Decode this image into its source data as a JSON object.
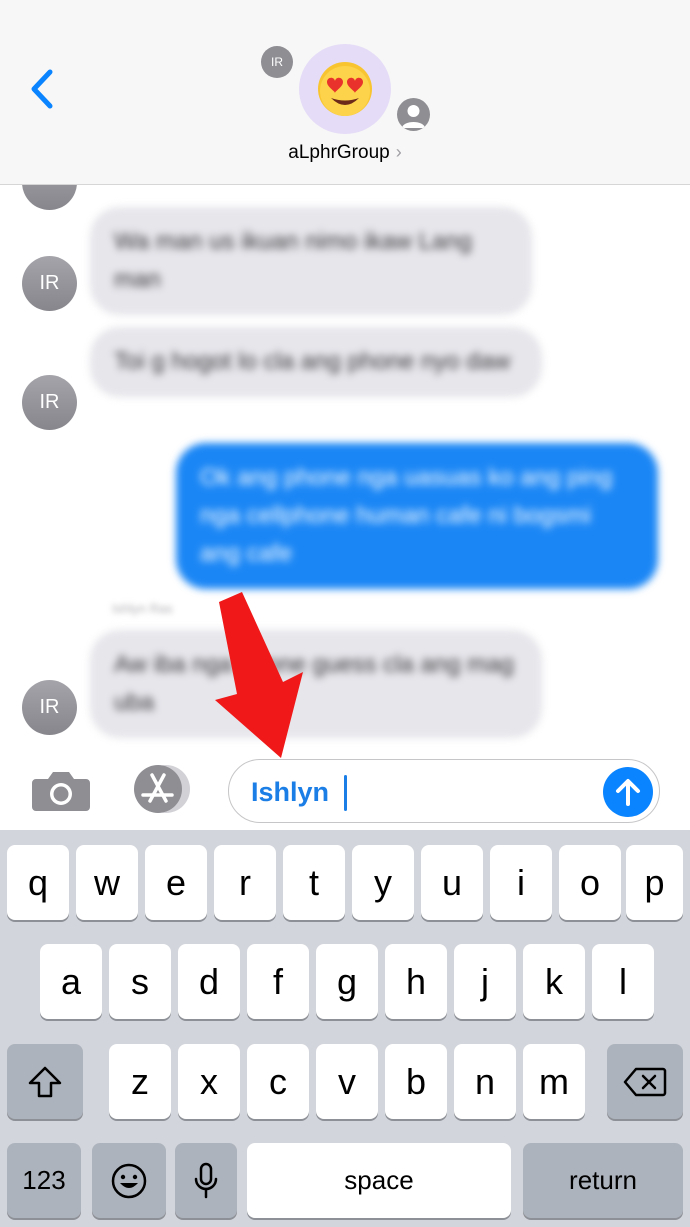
{
  "header": {
    "group_name": "aLphrGroup",
    "chevron": "›",
    "mini_avatar_initials": "IR",
    "group_emoji": "😍"
  },
  "thread": {
    "messages": [
      {
        "sender": "IR",
        "text": "Wa man us ikuan nimo ikaw Lang man"
      },
      {
        "sender": "IR",
        "text": "Toi g hogot lo cla ang phone nyo daw"
      },
      {
        "sender": "me",
        "text": "Ok ang phone nga uasuas ko ang ping nga cellphone human cafe ni bogsmi ang cafe"
      },
      {
        "sender": "IR",
        "text": "Aw iba nga phone guess cla ang mag uba"
      }
    ],
    "timestamp": "Ishlyn Ras"
  },
  "composer": {
    "input_value": "Ishlyn"
  },
  "keyboard": {
    "row1": [
      "q",
      "w",
      "e",
      "r",
      "t",
      "y",
      "u",
      "i",
      "o",
      "p"
    ],
    "row2": [
      "a",
      "s",
      "d",
      "f",
      "g",
      "h",
      "j",
      "k",
      "l"
    ],
    "row3": [
      "z",
      "x",
      "c",
      "v",
      "b",
      "n",
      "m"
    ],
    "numbers_label": "123",
    "space_label": "space",
    "return_label": "return"
  },
  "colors": {
    "accent": "#0a84ff",
    "outgoing_bubble": "#1a86f5",
    "incoming_bubble": "#e6e6eb",
    "annotation_arrow": "#f01818"
  }
}
